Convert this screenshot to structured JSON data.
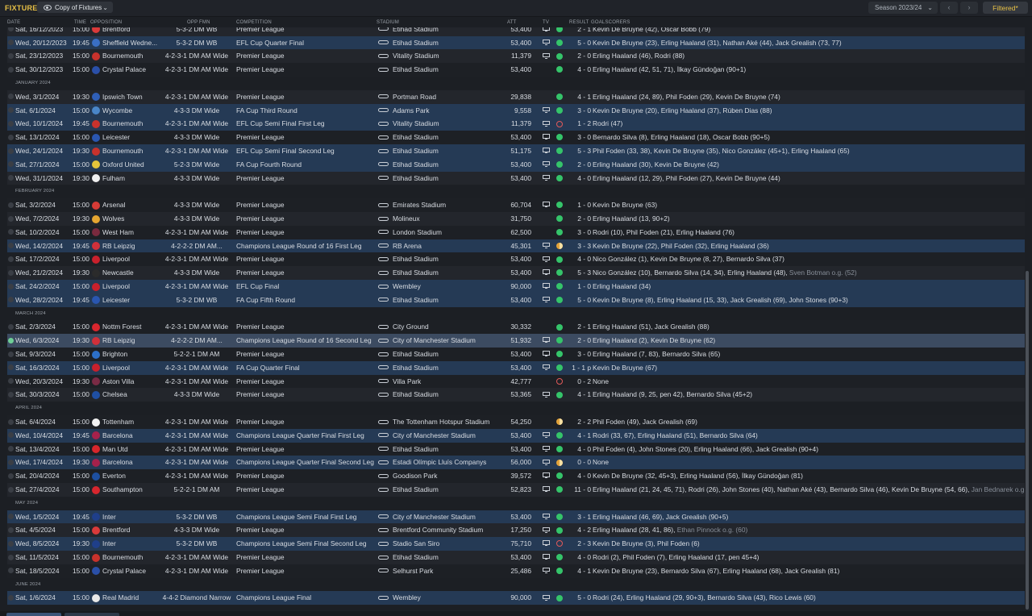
{
  "header": {
    "title": "FIXTURES",
    "view_dropdown": "Copy of Fixtures",
    "season": "Season 2023/24",
    "filter_button": "Filtered*"
  },
  "columns": {
    "date": "DATE",
    "time": "TIME",
    "opposition": "OPPOSITION",
    "formation": "OPP FMN",
    "competition": "COMPETITION",
    "stadium": "STADIUM",
    "att": "ATT",
    "tv": "TV",
    "result": "RESULT",
    "goalscorers": "GOALSCORERS"
  },
  "colors": {
    "accent": "#e8c146",
    "win": "#35c46a",
    "draw": "#e2a33b",
    "loss": "#e25a5a",
    "cup_row": "#253a55",
    "selected_row": "#3c4b61"
  },
  "rows": [
    {
      "type": "match",
      "date": "Sat, 16/12/2023",
      "time": "15:00",
      "opp": "Brentford",
      "crest": "#d93a3a",
      "fmn": "5-3-2 DM WB",
      "comp": "Premier League",
      "stadium": "Etihad Stadium",
      "att": "53,400",
      "tv": true,
      "res": "win",
      "score": "2 - 1",
      "scorers": "Kevin De Bruyne (42), Oscar Bobb (79)",
      "og": "",
      "cup": false
    },
    {
      "type": "match",
      "date": "Wed, 20/12/2023",
      "time": "19:45",
      "opp": "Sheffield Wedne...",
      "crest": "#3a6fc4",
      "fmn": "5-3-2 DM WB",
      "comp": "EFL Cup Quarter Final",
      "stadium": "Etihad Stadium",
      "att": "53,400",
      "tv": true,
      "res": "win",
      "score": "5 - 0",
      "scorers": "Kevin De Bruyne (23), Erling Haaland (31), Nathan Aké (44), Jack Grealish (73, 77)",
      "og": "",
      "cup": true
    },
    {
      "type": "match",
      "date": "Sat, 23/12/2023",
      "time": "15:00",
      "opp": "Bournemouth",
      "crest": "#c8322c",
      "fmn": "4-2-3-1 DM AM Wide",
      "comp": "Premier League",
      "stadium": "Vitality Stadium",
      "att": "11,379",
      "tv": true,
      "res": "win",
      "score": "2 - 0",
      "scorers": "Erling Haaland (46), Rodri (88)",
      "og": "",
      "cup": false
    },
    {
      "type": "match",
      "date": "Sat, 30/12/2023",
      "time": "15:00",
      "opp": "Crystal Palace",
      "crest": "#2a4fa8",
      "fmn": "4-2-3-1 DM AM Wide",
      "comp": "Premier League",
      "stadium": "Etihad Stadium",
      "att": "53,400",
      "tv": false,
      "res": "win",
      "score": "4 - 0",
      "scorers": "Erling Haaland (42, 51, 71), İlkay Gündoğan (90+1)",
      "og": "",
      "cup": false
    },
    {
      "type": "month",
      "label": "JANUARY 2024"
    },
    {
      "type": "match",
      "date": "Wed, 3/1/2024",
      "time": "19:30",
      "opp": "Ipswich Town",
      "crest": "#2f5fb8",
      "fmn": "4-2-3-1 DM AM Wide",
      "comp": "Premier League",
      "stadium": "Portman Road",
      "att": "29,838",
      "tv": false,
      "res": "win",
      "score": "4 - 1",
      "scorers": "Erling Haaland (24, 89), Phil Foden (29), Kevin De Bruyne (74)",
      "og": "",
      "cup": false
    },
    {
      "type": "match",
      "date": "Sat, 6/1/2024",
      "time": "15:00",
      "opp": "Wycombe",
      "crest": "#4a86c8",
      "fmn": "4-3-3 DM Wide",
      "comp": "FA Cup Third Round",
      "stadium": "Adams Park",
      "att": "9,558",
      "tv": true,
      "res": "win",
      "score": "3 - 0",
      "scorers": "Kevin De Bruyne (20), Erling Haaland (37), Rúben Dias (88)",
      "og": "",
      "cup": true
    },
    {
      "type": "match",
      "date": "Wed, 10/1/2024",
      "time": "19:45",
      "opp": "Bournemouth",
      "crest": "#c8322c",
      "fmn": "4-2-3-1 DM AM Wide",
      "comp": "EFL Cup Semi Final First Leg",
      "stadium": "Vitality Stadium",
      "att": "11,379",
      "tv": true,
      "res": "loss",
      "score": "1 - 2",
      "scorers": "Rodri (47)",
      "og": "",
      "cup": true
    },
    {
      "type": "match",
      "date": "Sat, 13/1/2024",
      "time": "15:00",
      "opp": "Leicester",
      "crest": "#2a56b0",
      "fmn": "4-3-3 DM Wide",
      "comp": "Premier League",
      "stadium": "Etihad Stadium",
      "att": "53,400",
      "tv": true,
      "res": "win",
      "score": "3 - 0",
      "scorers": "Bernardo Silva (8), Erling Haaland (18), Oscar Bobb (90+5)",
      "og": "",
      "cup": false
    },
    {
      "type": "match",
      "date": "Wed, 24/1/2024",
      "time": "19:30",
      "opp": "Bournemouth",
      "crest": "#c8322c",
      "fmn": "4-2-3-1 DM AM Wide",
      "comp": "EFL Cup Semi Final Second Leg",
      "stadium": "Etihad Stadium",
      "att": "51,175",
      "tv": true,
      "res": "win",
      "score": "5 - 3",
      "scorers": "Phil Foden (33, 38), Kevin De Bruyne (35), Nico González (45+1), Erling Haaland (65)",
      "og": "",
      "cup": true
    },
    {
      "type": "match",
      "date": "Sat, 27/1/2024",
      "time": "15:00",
      "opp": "Oxford United",
      "crest": "#e4c43a",
      "fmn": "5-2-3 DM Wide",
      "comp": "FA Cup Fourth Round",
      "stadium": "Etihad Stadium",
      "att": "53,400",
      "tv": true,
      "res": "win",
      "score": "2 - 0",
      "scorers": "Erling Haaland (30), Kevin De Bruyne (42)",
      "og": "",
      "cup": true
    },
    {
      "type": "match",
      "date": "Wed, 31/1/2024",
      "time": "19:30",
      "opp": "Fulham",
      "crest": "#f0f0f0",
      "fmn": "4-3-3 DM Wide",
      "comp": "Premier League",
      "stadium": "Etihad Stadium",
      "att": "53,400",
      "tv": true,
      "res": "win",
      "score": "4 - 0",
      "scorers": "Erling Haaland (12, 29), Phil Foden (27), Kevin De Bruyne (44)",
      "og": "",
      "cup": false
    },
    {
      "type": "month",
      "label": "FEBRUARY 2024"
    },
    {
      "type": "match",
      "date": "Sat, 3/2/2024",
      "time": "15:00",
      "opp": "Arsenal",
      "crest": "#d63b36",
      "fmn": "4-3-3 DM Wide",
      "comp": "Premier League",
      "stadium": "Emirates Stadium",
      "att": "60,704",
      "tv": true,
      "res": "win",
      "score": "1 - 0",
      "scorers": "Kevin De Bruyne (63)",
      "og": "",
      "cup": false
    },
    {
      "type": "match",
      "date": "Wed, 7/2/2024",
      "time": "19:30",
      "opp": "Wolves",
      "crest": "#e5a631",
      "fmn": "4-3-3 DM Wide",
      "comp": "Premier League",
      "stadium": "Molineux",
      "att": "31,750",
      "tv": false,
      "res": "win",
      "score": "2 - 0",
      "scorers": "Erling Haaland (13, 90+2)",
      "og": "",
      "cup": false
    },
    {
      "type": "match",
      "date": "Sat, 10/2/2024",
      "time": "15:00",
      "opp": "West Ham",
      "crest": "#7a2a3e",
      "fmn": "4-2-3-1 DM AM Wide",
      "comp": "Premier League",
      "stadium": "London Stadium",
      "att": "62,500",
      "tv": false,
      "res": "win",
      "score": "3 - 0",
      "scorers": "Rodri (10), Phil Foden (21), Erling Haaland (76)",
      "og": "",
      "cup": false
    },
    {
      "type": "match",
      "date": "Wed, 14/2/2024",
      "time": "19:45",
      "opp": "RB Leipzig",
      "crest": "#d0303a",
      "fmn": "4-2-2-2 DM AM...",
      "comp": "Champions League Round of 16 First Leg",
      "stadium": "RB Arena",
      "att": "45,301",
      "tv": true,
      "res": "draw",
      "score": "3 - 3",
      "scorers": "Kevin De Bruyne (22), Phil Foden (32), Erling Haaland (36)",
      "og": "",
      "cup": true
    },
    {
      "type": "match",
      "date": "Sat, 17/2/2024",
      "time": "15:00",
      "opp": "Liverpool",
      "crest": "#c8202c",
      "fmn": "4-2-3-1 DM AM Wide",
      "comp": "Premier League",
      "stadium": "Etihad Stadium",
      "att": "53,400",
      "tv": true,
      "res": "win",
      "score": "4 - 0",
      "scorers": "Nico González (1), Kevin De Bruyne (8, 27), Bernardo Silva (37)",
      "og": "",
      "cup": false
    },
    {
      "type": "match",
      "date": "Wed, 21/2/2024",
      "time": "19:30",
      "opp": "Newcastle",
      "crest": "#2b2b2b",
      "fmn": "4-3-3 DM Wide",
      "comp": "Premier League",
      "stadium": "Etihad Stadium",
      "att": "53,400",
      "tv": true,
      "res": "win",
      "score": "5 - 3",
      "scorers": "Nico González (10), Bernardo Silva (14, 34), Erling Haaland (48), ",
      "og": "Sven Botman o.g. (52)",
      "cup": false
    },
    {
      "type": "match",
      "date": "Sat, 24/2/2024",
      "time": "15:00",
      "opp": "Liverpool",
      "crest": "#c8202c",
      "fmn": "4-2-3-1 DM AM Wide",
      "comp": "EFL Cup Final",
      "stadium": "Wembley",
      "att": "90,000",
      "tv": true,
      "res": "win",
      "score": "1 - 0",
      "scorers": "Erling Haaland (34)",
      "og": "",
      "cup": true
    },
    {
      "type": "match",
      "date": "Wed, 28/2/2024",
      "time": "19:45",
      "opp": "Leicester",
      "crest": "#2a56b0",
      "fmn": "5-3-2 DM WB",
      "comp": "FA Cup Fifth Round",
      "stadium": "Etihad Stadium",
      "att": "53,400",
      "tv": true,
      "res": "win",
      "score": "5 - 0",
      "scorers": "Kevin De Bruyne (8), Erling Haaland (15, 33), Jack Grealish (69), John Stones (90+3)",
      "og": "",
      "cup": true
    },
    {
      "type": "month",
      "label": "MARCH 2024"
    },
    {
      "type": "match",
      "date": "Sat, 2/3/2024",
      "time": "15:00",
      "opp": "Nottm Forest",
      "crest": "#d9262e",
      "fmn": "4-2-3-1 DM AM Wide",
      "comp": "Premier League",
      "stadium": "City Ground",
      "att": "30,332",
      "tv": false,
      "res": "win",
      "score": "2 - 1",
      "scorers": "Erling Haaland (51), Jack Grealish (88)",
      "og": "",
      "cup": false
    },
    {
      "type": "match",
      "date": "Wed, 6/3/2024",
      "time": "19:30",
      "opp": "RB Leipzig",
      "crest": "#d0303a",
      "fmn": "4-2-2-2 DM AM...",
      "comp": "Champions League Round of 16 Second Leg",
      "stadium": "City of Manchester Stadium",
      "att": "51,932",
      "tv": true,
      "res": "win",
      "score": "2 - 0",
      "scorers": "Erling Haaland (2), Kevin De Bruyne (62)",
      "og": "",
      "cup": true,
      "selected": true
    },
    {
      "type": "match",
      "date": "Sat, 9/3/2024",
      "time": "15:00",
      "opp": "Brighton",
      "crest": "#2c6fc8",
      "fmn": "5-2-2-1 DM AM",
      "comp": "Premier League",
      "stadium": "Etihad Stadium",
      "att": "53,400",
      "tv": true,
      "res": "win",
      "score": "3 - 0",
      "scorers": "Erling Haaland (7, 83), Bernardo Silva (65)",
      "og": "",
      "cup": false
    },
    {
      "type": "match",
      "date": "Sat, 16/3/2024",
      "time": "15:00",
      "opp": "Liverpool",
      "crest": "#c8202c",
      "fmn": "4-2-3-1 DM AM Wide",
      "comp": "FA Cup Quarter Final",
      "stadium": "Etihad Stadium",
      "att": "53,400",
      "tv": true,
      "res": "win",
      "score": "1 - 1 p",
      "scorers": "Kevin De Bruyne (67)",
      "og": "",
      "cup": true
    },
    {
      "type": "match",
      "date": "Wed, 20/3/2024",
      "time": "19:30",
      "opp": "Aston Villa",
      "crest": "#7a2b45",
      "fmn": "4-2-3-1 DM AM Wide",
      "comp": "Premier League",
      "stadium": "Villa Park",
      "att": "42,777",
      "tv": false,
      "res": "loss",
      "score": "0 - 2",
      "scorers": "None",
      "og": "",
      "cup": false
    },
    {
      "type": "match",
      "date": "Sat, 30/3/2024",
      "time": "15:00",
      "opp": "Chelsea",
      "crest": "#1f4fa3",
      "fmn": "4-3-3 DM Wide",
      "comp": "Premier League",
      "stadium": "Etihad Stadium",
      "att": "53,365",
      "tv": true,
      "res": "win",
      "score": "4 - 1",
      "scorers": "Erling Haaland (9, 25, pen 42), Bernardo Silva (45+2)",
      "og": "",
      "cup": false
    },
    {
      "type": "month",
      "label": "APRIL 2024"
    },
    {
      "type": "match",
      "date": "Sat, 6/4/2024",
      "time": "15:00",
      "opp": "Tottenham",
      "crest": "#f2f2f2",
      "fmn": "4-2-3-1 DM AM Wide",
      "comp": "Premier League",
      "stadium": "The Tottenham Hotspur Stadium",
      "att": "54,250",
      "tv": false,
      "res": "draw",
      "score": "2 - 2",
      "scorers": "Phil Foden (49), Jack Grealish (69)",
      "og": "",
      "cup": false
    },
    {
      "type": "match",
      "date": "Wed, 10/4/2024",
      "time": "19:45",
      "opp": "Barcelona",
      "crest": "#a5214b",
      "fmn": "4-2-3-1 DM AM Wide",
      "comp": "Champions League Quarter Final First Leg",
      "stadium": "City of Manchester Stadium",
      "att": "53,400",
      "tv": true,
      "res": "win",
      "score": "4 - 1",
      "scorers": "Rodri (33, 67), Erling Haaland (51), Bernardo Silva (64)",
      "og": "",
      "cup": true
    },
    {
      "type": "match",
      "date": "Sat, 13/4/2024",
      "time": "15:00",
      "opp": "Man Utd",
      "crest": "#d7262b",
      "fmn": "4-2-3-1 DM AM Wide",
      "comp": "Premier League",
      "stadium": "Etihad Stadium",
      "att": "53,400",
      "tv": true,
      "res": "win",
      "score": "4 - 0",
      "scorers": "Phil Foden (4), John Stones (20), Erling Haaland (66), Jack Grealish (90+4)",
      "og": "",
      "cup": false
    },
    {
      "type": "match",
      "date": "Wed, 17/4/2024",
      "time": "19:30",
      "opp": "Barcelona",
      "crest": "#a5214b",
      "fmn": "4-2-3-1 DM AM Wide",
      "comp": "Champions League Quarter Final Second Leg",
      "stadium": "Estadi Olímpic Lluís Companys",
      "att": "56,000",
      "tv": true,
      "res": "draw",
      "score": "0 - 0",
      "scorers": "None",
      "og": "",
      "cup": true
    },
    {
      "type": "match",
      "date": "Sat, 20/4/2024",
      "time": "15:00",
      "opp": "Everton",
      "crest": "#1d4fa0",
      "fmn": "4-2-3-1 DM AM Wide",
      "comp": "Premier League",
      "stadium": "Goodison Park",
      "att": "39,572",
      "tv": true,
      "res": "win",
      "score": "4 - 0",
      "scorers": "Kevin De Bruyne (32, 45+3), Erling Haaland (56), İlkay Gündoğan (81)",
      "og": "",
      "cup": false
    },
    {
      "type": "match",
      "date": "Sat, 27/4/2024",
      "time": "15:00",
      "opp": "Southampton",
      "crest": "#d7262e",
      "fmn": "5-2-2-1 DM AM",
      "comp": "Premier League",
      "stadium": "Etihad Stadium",
      "att": "52,823",
      "tv": true,
      "res": "win",
      "score": "11 - 0",
      "scorers": "Erling Haaland (21, 24, 45, 71), Rodri (26), John Stones (40), Nathan Aké (43), Bernardo Silva (46), Kevin De Bruyne (54, 66), ",
      "og": "Jan Bednarek o.g. (80)",
      "cup": false
    },
    {
      "type": "month",
      "label": "MAY 2024"
    },
    {
      "type": "match",
      "date": "Wed, 1/5/2024",
      "time": "19:45",
      "opp": "Inter",
      "crest": "#1f3f8a",
      "fmn": "5-3-2 DM WB",
      "comp": "Champions League Semi Final First Leg",
      "stadium": "City of Manchester Stadium",
      "att": "53,400",
      "tv": true,
      "res": "win",
      "score": "3 - 1",
      "scorers": "Erling Haaland (46, 69), Jack Grealish (90+5)",
      "og": "",
      "cup": true
    },
    {
      "type": "match",
      "date": "Sat, 4/5/2024",
      "time": "15:00",
      "opp": "Brentford",
      "crest": "#d93a3a",
      "fmn": "4-3-3 DM Wide",
      "comp": "Premier League",
      "stadium": "Brentford Community Stadium",
      "att": "17,250",
      "tv": true,
      "res": "win",
      "score": "4 - 2",
      "scorers": "Erling Haaland (28, 41, 86), ",
      "og": "Ethan Pinnock o.g. (60)",
      "cup": false
    },
    {
      "type": "match",
      "date": "Wed, 8/5/2024",
      "time": "19:30",
      "opp": "Inter",
      "crest": "#1f3f8a",
      "fmn": "5-3-2 DM WB",
      "comp": "Champions League Semi Final Second Leg",
      "stadium": "Stadio San Siro",
      "att": "75,710",
      "tv": true,
      "res": "loss",
      "score": "2 - 3",
      "scorers": "Kevin De Bruyne (3), Phil Foden (6)",
      "og": "",
      "cup": true
    },
    {
      "type": "match",
      "date": "Sat, 11/5/2024",
      "time": "15:00",
      "opp": "Bournemouth",
      "crest": "#c8322c",
      "fmn": "4-2-3-1 DM AM Wide",
      "comp": "Premier League",
      "stadium": "Etihad Stadium",
      "att": "53,400",
      "tv": true,
      "res": "win",
      "score": "4 - 0",
      "scorers": "Rodri (2), Phil Foden (7), Erling Haaland (17, pen 45+4)",
      "og": "",
      "cup": false
    },
    {
      "type": "match",
      "date": "Sat, 18/5/2024",
      "time": "15:00",
      "opp": "Crystal Palace",
      "crest": "#2a4fa8",
      "fmn": "4-2-3-1 DM AM Wide",
      "comp": "Premier League",
      "stadium": "Selhurst Park",
      "att": "25,486",
      "tv": true,
      "res": "win",
      "score": "4 - 1",
      "scorers": "Kevin De Bruyne (23), Bernardo Silva (67), Erling Haaland (68), Jack Grealish (81)",
      "og": "",
      "cup": false
    },
    {
      "type": "month",
      "label": "JUNE 2024"
    },
    {
      "type": "match",
      "date": "Sat, 1/6/2024",
      "time": "15:00",
      "opp": "Real Madrid",
      "crest": "#e8e8e8",
      "fmn": "4-4-2 Diamond Narrow",
      "comp": "Champions League Final",
      "stadium": "Wembley",
      "att": "90,000",
      "tv": true,
      "res": "win",
      "score": "5 - 0",
      "scorers": "Rodri (24), Erling Haaland (29, 90+3), Bernardo Silva (43), Rico Lewis (60)",
      "og": "",
      "cup": true
    }
  ]
}
